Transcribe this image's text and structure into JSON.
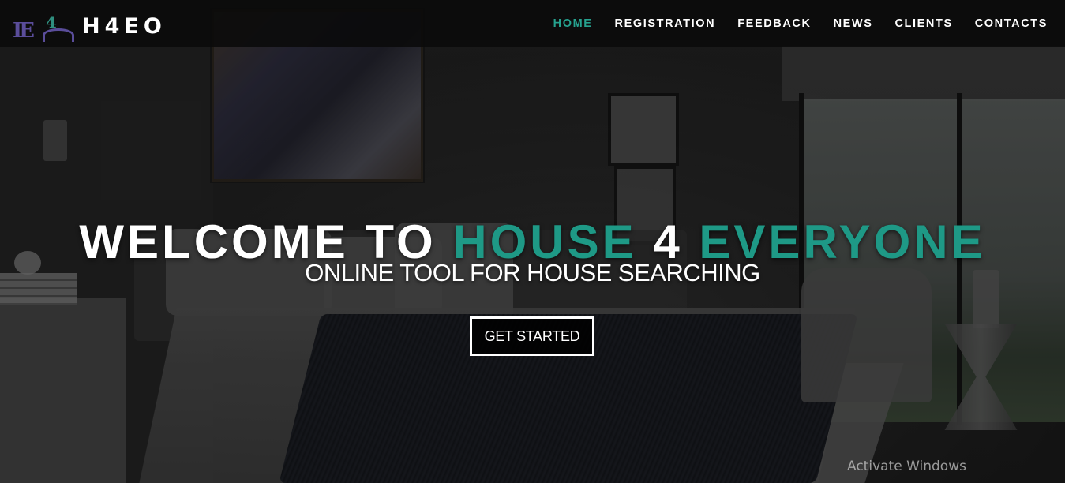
{
  "logo": {
    "mark_text_1": "IE",
    "mark_text_2": "4",
    "wordmark": "H4EO"
  },
  "nav": {
    "items": [
      {
        "label": "HOME",
        "active": true
      },
      {
        "label": "REGISTRATION",
        "active": false
      },
      {
        "label": "FEEDBACK",
        "active": false
      },
      {
        "label": "NEWS",
        "active": false
      },
      {
        "label": "CLIENTS",
        "active": false
      },
      {
        "label": "CONTACTS",
        "active": false
      }
    ]
  },
  "hero": {
    "headline_part1": "WELCOME TO ",
    "headline_accent1": "HOUSE",
    "headline_part2": " 4 ",
    "headline_accent2": "EVERYONE",
    "subtitle": "ONLINE TOOL FOR HOUSE SEARCHING",
    "cta_label": "GET STARTED"
  },
  "system": {
    "watermark": "Activate Windows"
  },
  "colors": {
    "accent": "#1e9986",
    "nav_active": "#26a28f",
    "logo_purple": "#5a4d9a",
    "navbar_bg": "#0a0a0a"
  }
}
